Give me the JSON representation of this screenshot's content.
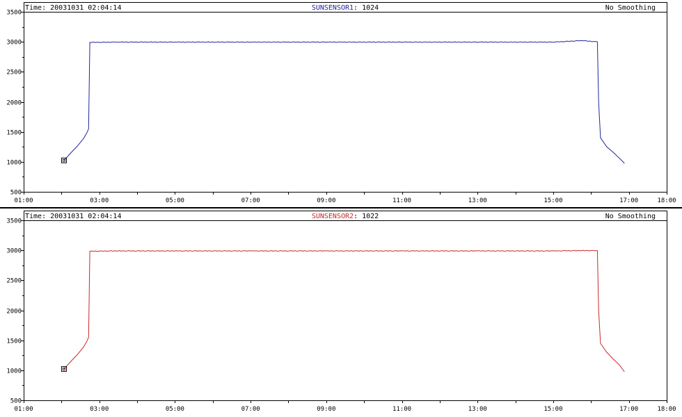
{
  "chart_data": [
    {
      "type": "line",
      "header": {
        "time_label": "Time:",
        "time_value": "20031031 02:04:14",
        "sensor_name": "SUNSENSOR1",
        "sensor_value": "1024",
        "smoothing": "No Smoothing"
      },
      "color": "#2323a0",
      "xlim": [
        "01:00",
        "18:00"
      ],
      "ylim": [
        500,
        3500
      ],
      "x_ticks": [
        "01:00",
        "03:00",
        "05:00",
        "07:00",
        "09:00",
        "11:00",
        "13:00",
        "15:00",
        "17:00",
        "18:00"
      ],
      "y_ticks": [
        "500",
        "1000",
        "1500",
        "2000",
        "2500",
        "3000",
        "3500"
      ],
      "marker": {
        "x": "02:04",
        "y": 1024
      },
      "series": [
        {
          "x": [
            "02:04",
            "02:15",
            "02:25",
            "02:35",
            "02:40",
            "02:43",
            "02:45",
            "03:30",
            "05:00",
            "07:00",
            "09:00",
            "11:00",
            "13:00",
            "15:00",
            "15:45",
            "16:10",
            "16:12",
            "16:15",
            "16:25",
            "16:35",
            "16:45",
            "16:53"
          ],
          "y": [
            1024,
            1150,
            1260,
            1390,
            1480,
            1550,
            2990,
            2995,
            2995,
            2995,
            2995,
            2995,
            2995,
            2995,
            3020,
            3000,
            2000,
            1400,
            1250,
            1160,
            1060,
            975
          ]
        }
      ]
    },
    {
      "type": "line",
      "header": {
        "time_label": "Time:",
        "time_value": "20031031 02:04:14",
        "sensor_name": "SUNSENSOR2",
        "sensor_value": "1022",
        "smoothing": "No Smoothing"
      },
      "color": "#c82828",
      "xlim": [
        "01:00",
        "18:00"
      ],
      "ylim": [
        500,
        3500
      ],
      "x_ticks": [
        "01:00",
        "03:00",
        "05:00",
        "07:00",
        "09:00",
        "11:00",
        "13:00",
        "15:00",
        "17:00",
        "18:00"
      ],
      "y_ticks": [
        "500",
        "1000",
        "1500",
        "2000",
        "2500",
        "3000",
        "3500"
      ],
      "marker": {
        "x": "02:04",
        "y": 1022
      },
      "series": [
        {
          "x": [
            "02:04",
            "02:15",
            "02:25",
            "02:35",
            "02:40",
            "02:43",
            "02:45",
            "03:30",
            "05:00",
            "07:00",
            "09:00",
            "11:00",
            "13:00",
            "15:00",
            "15:45",
            "16:10",
            "16:12",
            "16:15",
            "16:25",
            "16:35",
            "16:45",
            "16:53"
          ],
          "y": [
            1022,
            1150,
            1260,
            1390,
            1480,
            1550,
            2985,
            2990,
            2990,
            2990,
            2990,
            2990,
            2990,
            2990,
            2995,
            2995,
            2000,
            1450,
            1300,
            1190,
            1090,
            975
          ]
        }
      ]
    }
  ]
}
